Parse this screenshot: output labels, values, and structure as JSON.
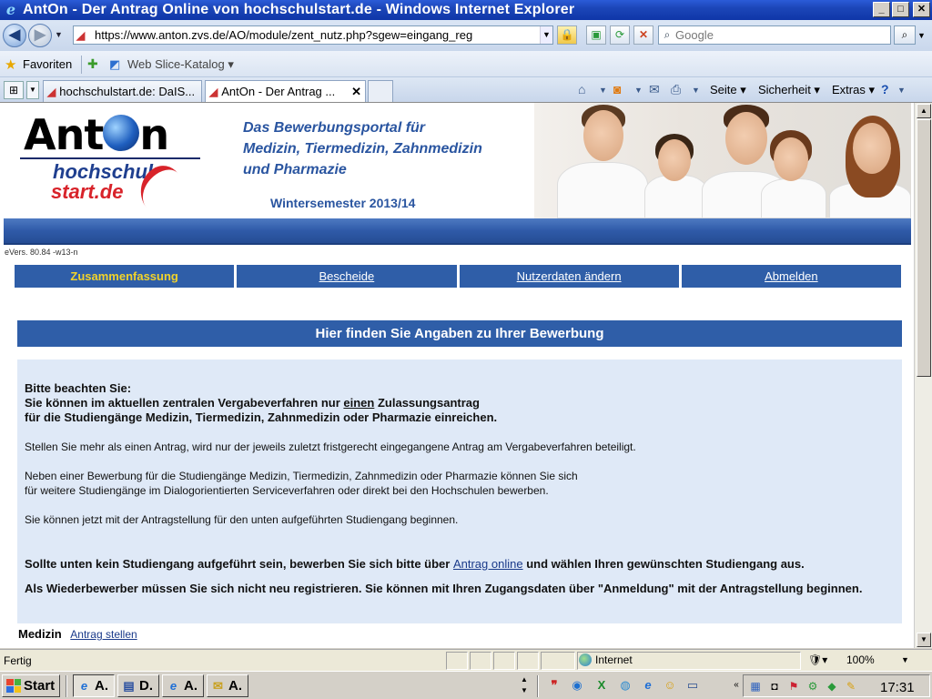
{
  "window": {
    "title": "AntOn - Der Antrag Online von hochschulstart.de - Windows Internet Explorer",
    "min": "_",
    "max": "□",
    "close": "✕"
  },
  "address": {
    "url": "https://www.anton.zvs.de/AO/module/zent_nutz.php?sgew=eingang_reg",
    "search_placeholder": "Google"
  },
  "favorites": {
    "label": "Favoriten",
    "slice_label": "Web Slice-Katalog ▾"
  },
  "tabs": [
    {
      "label": "hochschulstart.de: DaIS..."
    },
    {
      "label": "AntOn - Der Antrag ..."
    }
  ],
  "commands": {
    "page": "Seite ▾",
    "safety": "Sicherheit ▾",
    "extras": "Extras ▾"
  },
  "header": {
    "logo_ant": "Ant",
    "logo_n": "n",
    "logo_hochschul": "hochschul",
    "logo_start": "start.de",
    "portal_line1": "Das Bewerbungsportal für",
    "portal_line2": "Medizin, Tiermedizin, Zahnmedizin",
    "portal_line3": "und Pharmazie",
    "semester": "Wintersemester 2013/14"
  },
  "version": "eVers. 80.84 -w13-n",
  "nav": [
    {
      "label": "Zusammenfassung",
      "active": true
    },
    {
      "label": "Bescheide"
    },
    {
      "label": "Nutzerdaten ändern"
    },
    {
      "label": "Abmelden"
    }
  ],
  "heading": "Hier finden Sie Angaben zu Ihrer Bewerbung",
  "info": {
    "note_title": "Bitte beachten Sie:",
    "note_line1_a": " Sie können im aktuellen zentralen Vergabeverfahren nur ",
    "note_line1_u": "einen",
    "note_line1_b": " Zulassungsantrag",
    "note_line2": " für die Studiengänge Medizin, Tiermedizin, Zahnmedizin oder Pharmazie einreichen.",
    "para1": "Stellen Sie mehr als einen Antrag, wird nur der jeweils zuletzt fristgerecht eingegangene Antrag am Vergabeverfahren beteiligt.",
    "para2_line1": "Neben einer Bewerbung für die Studiengänge Medizin, Tiermedizin, Zahnmedizin oder Pharmazie können Sie sich",
    "para2_line2": "für weitere Studiengänge im Dialogorientierten Serviceverfahren oder direkt bei den Hochschulen bewerben.",
    "para3": "Sie können jetzt mit der Antragstellung für den unten aufgeführten Studiengang beginnen.",
    "bold1_a": " Sollte unten kein Studiengang aufgeführt sein, bewerben Sie sich bitte über ",
    "bold1_link": "Antrag online",
    "bold1_b": " und wählen Ihren gewünschten Studiengang aus.",
    "bold2": "Als Wiederbewerber müssen Sie sich nicht neu registrieren. Sie können mit Ihren Zugangsdaten über \"Anmeldung\" mit der Antragstellung beginnen."
  },
  "medizin": {
    "label": "Medizin",
    "link": "Antrag stellen"
  },
  "status": {
    "text": "Fertig",
    "zone": "Internet",
    "zoom": "100%"
  },
  "taskbar": {
    "start": "Start",
    "items": [
      {
        "label": "A."
      },
      {
        "label": "D."
      },
      {
        "label": "A."
      },
      {
        "label": "A."
      }
    ],
    "clock": "17:31"
  }
}
